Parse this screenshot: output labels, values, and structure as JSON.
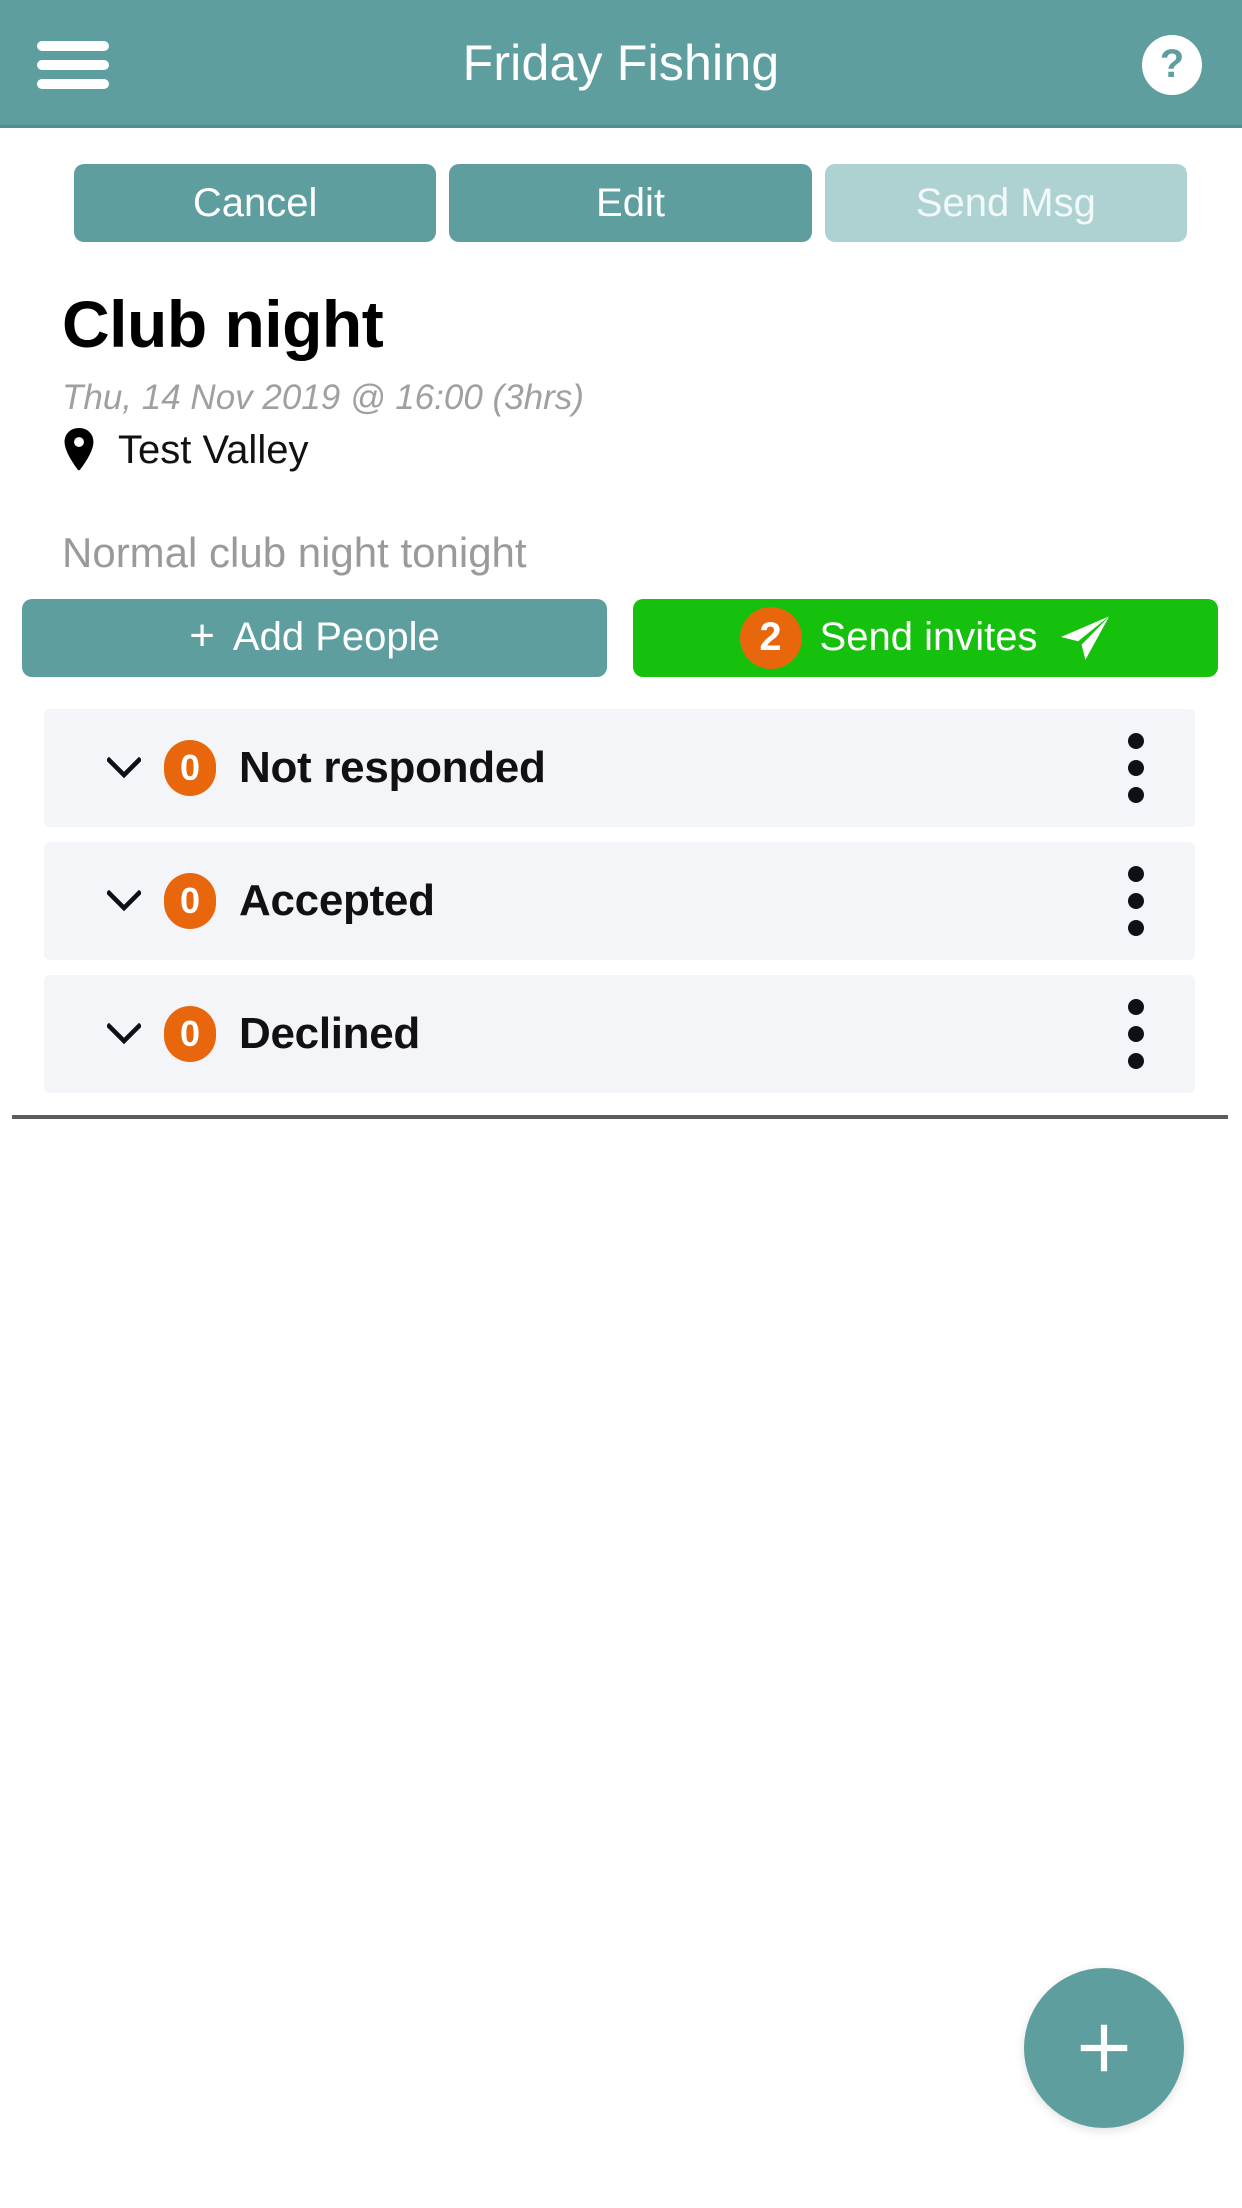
{
  "appbar": {
    "title": "Friday Fishing",
    "menu_icon": "hamburger-menu-icon",
    "help_label": "?",
    "background_color": "#5e9e9e"
  },
  "top_actions": [
    {
      "label": "Cancel",
      "state": "enabled"
    },
    {
      "label": "Edit",
      "state": "enabled"
    },
    {
      "label": "Send Msg",
      "state": "disabled"
    }
  ],
  "event": {
    "title": "Club night",
    "when": "Thu, 14 Nov 2019 @ 16:00 (3hrs)",
    "location_icon": "map-pin-icon",
    "location": "Test Valley",
    "description": "Normal club night tonight"
  },
  "invite_actions": {
    "add_people": {
      "label": "Add People",
      "plus": "+",
      "color": "#5e9e9e"
    },
    "send_invites": {
      "label": "Send invites",
      "badge": "2",
      "badge_color": "#e8670c",
      "icon": "paper-plane-icon",
      "color": "#16c10d"
    }
  },
  "status_groups": [
    {
      "label": "Not responded",
      "count": "0",
      "chevron": "chevron-down-icon",
      "menu": "kebab-menu-icon"
    },
    {
      "label": "Accepted",
      "count": "0",
      "chevron": "chevron-down-icon",
      "menu": "kebab-menu-icon"
    },
    {
      "label": "Declined",
      "count": "0",
      "chevron": "chevron-down-icon",
      "menu": "kebab-menu-icon"
    }
  ],
  "fab": {
    "icon": "plus-icon",
    "color": "#5e9e9e"
  },
  "colors": {
    "teal": "#5e9e9e",
    "teal_disabled": "#aed2d2",
    "green": "#16c10d",
    "orange": "#e8670c",
    "row_bg": "#f3f5f9",
    "muted_text": "#9a9a9a"
  }
}
